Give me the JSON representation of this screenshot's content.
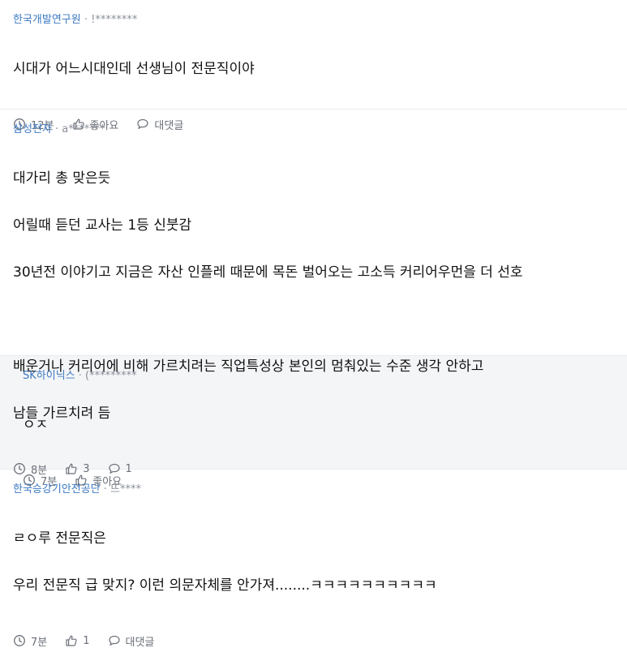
{
  "comments": [
    {
      "company": "한국개발연구원",
      "sep": " · ",
      "user": "!********",
      "lines": [
        "시대가 어느시대인데 선생님이 전문직이야"
      ],
      "time": "12분",
      "like": "좋아요",
      "reply": "대댓글"
    },
    {
      "company": "삼성전자",
      "sep": " · ",
      "user": "a*******",
      "lines": [
        "대가리 총 맞은듯",
        "어릴때 듣던 교사는 1등 신붓감",
        "30년전 이야기고 지금은 자산 인플레 때문에 목돈 벌어오는 고소득 커리어우먼을 더 선호",
        "",
        "배운거나 커리어에 비해 가르치려는 직업특성상 본인의 멈춰있는 수준 생각 안하고",
        "남들 가르치려 듬"
      ],
      "time": "8분",
      "like": "3",
      "reply": "1"
    },
    {
      "company": "SK하이닉스",
      "sep": " · ",
      "user": "(*********",
      "lines": [
        "ㅇㅈ"
      ],
      "time": "7분",
      "like": "좋아요"
    },
    {
      "company": "한국승강기안전공단",
      "sep": " · ",
      "user": "뜨****",
      "lines": [
        "ㄹㅇ루 전문직은",
        "우리 전문직 급 맞지? 이런 의문자체를 안가져........ㅋㅋㅋㅋㅋㅋㅋㅋㅋㅋ"
      ],
      "time": "7분",
      "like": "1",
      "reply": "대댓글"
    }
  ],
  "icons": {
    "time": "clock-icon",
    "like": "thumbs-up-icon",
    "reply": "speech-bubble-icon"
  },
  "colors": {
    "company": "#3d79c2",
    "reply_bg": "#f4f5f7",
    "meta": "#8a8f99"
  }
}
